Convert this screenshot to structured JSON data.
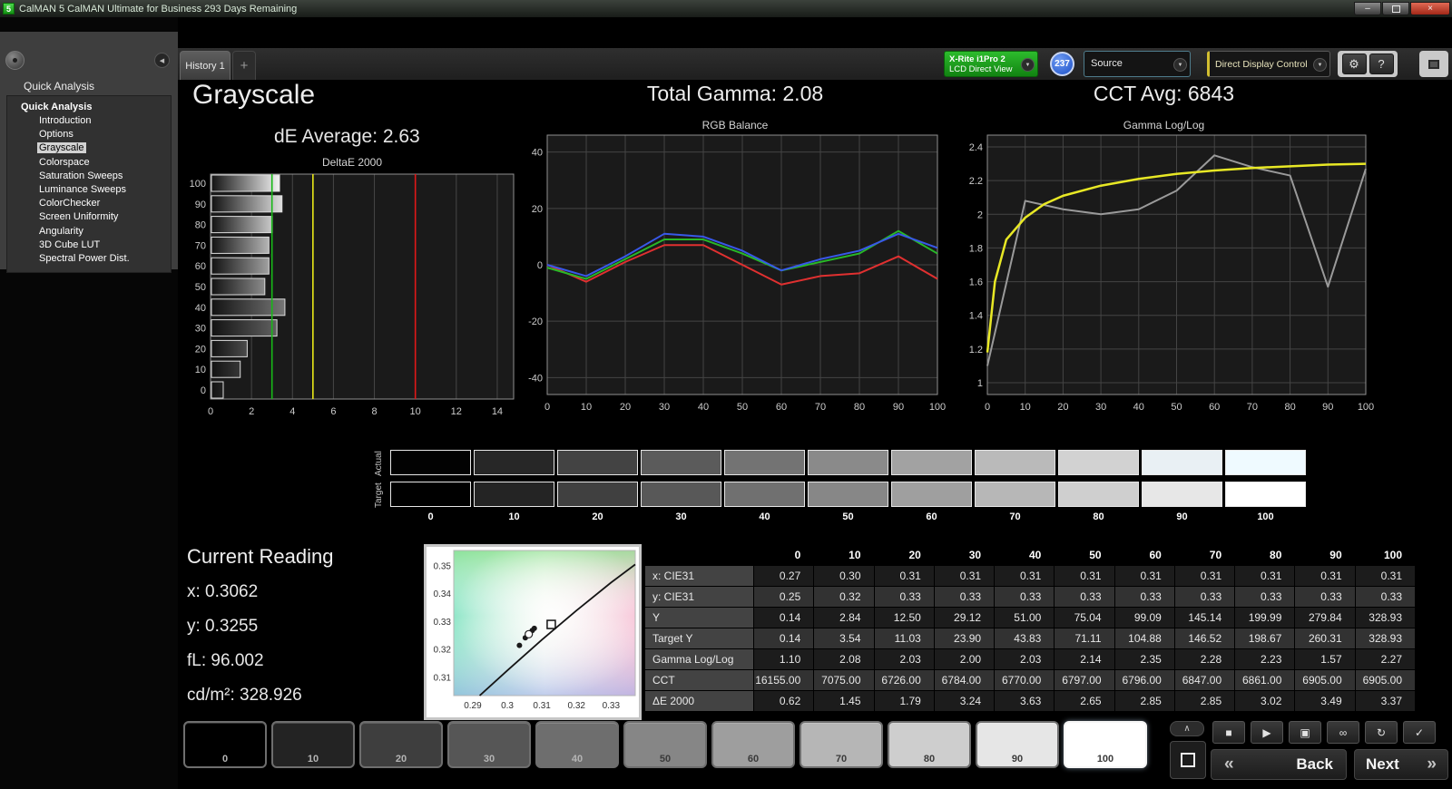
{
  "window": {
    "icon_label": "5",
    "title": "CalMAN 5 CalMAN Ultimate for Business 293 Days Remaining",
    "logo": "CalMAN 5",
    "minimize": "–",
    "close": "×"
  },
  "glyphs": {
    "caret_down": "▼",
    "collapse_left": "◀",
    "gear": "⚙"
  },
  "toolbar": {
    "history_tab": "History 1",
    "add_tab": "+",
    "meter": {
      "line1": "X-Rite i1Pro 2",
      "line2": "LCD Direct View"
    },
    "meter_badge": "237",
    "source_label": "Source",
    "display_control_label": "Direct Display Control",
    "help_label": "?"
  },
  "sidebar": {
    "header": "Quick Analysis",
    "root": "Quick Analysis",
    "items": [
      "Introduction",
      "Options",
      "Grayscale",
      "Colorspace",
      "Saturation Sweeps",
      "Luminance Sweeps",
      "ColorChecker",
      "Screen Uniformity",
      "Angularity",
      "3D Cube LUT",
      "Spectral Power Dist."
    ],
    "selected": "Grayscale"
  },
  "headings": {
    "page_title": "Grayscale",
    "de_average": "dE Average: 2.63",
    "total_gamma": "Total Gamma: 2.08",
    "cct_avg": "CCT Avg: 6843"
  },
  "chart_data": [
    {
      "type": "bar",
      "title": "DeltaE 2000",
      "orientation": "horizontal",
      "categories": [
        0,
        10,
        20,
        30,
        40,
        50,
        60,
        70,
        80,
        90,
        100
      ],
      "values": [
        0.62,
        1.45,
        1.79,
        3.24,
        3.63,
        2.65,
        2.85,
        2.85,
        3.02,
        3.49,
        3.37
      ],
      "xlim": [
        0,
        14.8
      ],
      "xticks": [
        0,
        2,
        4,
        6,
        8,
        10,
        12,
        14
      ],
      "reference_lines": [
        {
          "value": 3,
          "color": "#18b818"
        },
        {
          "value": 5,
          "color": "#e8e818"
        },
        {
          "value": 10,
          "color": "#e01818"
        }
      ]
    },
    {
      "type": "line",
      "title": "RGB Balance",
      "x": [
        0,
        10,
        20,
        30,
        40,
        50,
        60,
        70,
        80,
        90,
        100
      ],
      "ylim": [
        -46,
        46
      ],
      "yticks": [
        40,
        20,
        0,
        -20,
        -40
      ],
      "series": [
        {
          "name": "Red",
          "color": "#e03030",
          "values": [
            0,
            -6,
            1,
            7,
            7,
            0,
            -7,
            -4,
            -3,
            3,
            -5
          ]
        },
        {
          "name": "Green",
          "color": "#28b828",
          "values": [
            -1,
            -5,
            2,
            9,
            9,
            4,
            -2,
            1,
            4,
            12,
            4
          ]
        },
        {
          "name": "Blue",
          "color": "#3858e8",
          "values": [
            0,
            -4,
            3,
            11,
            10,
            5,
            -2,
            2,
            5,
            11,
            6
          ]
        }
      ]
    },
    {
      "type": "line",
      "title": "Gamma Log/Log",
      "x": [
        0,
        10,
        20,
        30,
        40,
        50,
        60,
        70,
        80,
        90,
        100
      ],
      "ylim": [
        0.93,
        2.47
      ],
      "yticks": [
        2.4,
        2.2,
        2,
        1.8,
        1.6,
        1.4,
        1.2,
        1
      ],
      "series": [
        {
          "name": "Measured",
          "color": "#9a9a9a",
          "values": [
            1.1,
            2.08,
            2.03,
            2.0,
            2.03,
            2.14,
            2.35,
            2.28,
            2.23,
            1.57,
            2.27
          ]
        }
      ],
      "target": {
        "name": "Target",
        "color": "#e8e825",
        "x": [
          0,
          2,
          5,
          10,
          15,
          20,
          30,
          40,
          50,
          60,
          70,
          80,
          90,
          100
        ],
        "y": [
          1.18,
          1.6,
          1.85,
          1.98,
          2.06,
          2.11,
          2.17,
          2.21,
          2.24,
          2.26,
          2.275,
          2.285,
          2.295,
          2.3
        ]
      }
    }
  ],
  "swatches": {
    "row_labels": [
      "Actual",
      "Target"
    ],
    "levels": [
      "0",
      "10",
      "20",
      "30",
      "40",
      "50",
      "60",
      "70",
      "80",
      "90",
      "100"
    ],
    "actual_colors": [
      "#020202",
      "#272727",
      "#434343",
      "#5b5b5b",
      "#737373",
      "#8a8a8a",
      "#a2a2a2",
      "#bababa",
      "#d2d2d2",
      "#e9f0f4",
      "#effaff"
    ],
    "target_colors": [
      "#000000",
      "#242424",
      "#404040",
      "#585858",
      "#707070",
      "#878787",
      "#9f9f9f",
      "#b7b7b7",
      "#cfcfcf",
      "#e7e7e7",
      "#ffffff"
    ]
  },
  "current_reading": {
    "title": "Current Reading",
    "lines": [
      {
        "label": "x:",
        "value": "0.3062"
      },
      {
        "label": "y:",
        "value": "0.3255"
      },
      {
        "label": "fL:",
        "value": "96.002"
      },
      {
        "label": "cd/m²:",
        "value": "328.926"
      }
    ]
  },
  "cie_chart": {
    "x_ticks": [
      "0.29",
      "0.3",
      "0.31",
      "0.32",
      "0.33"
    ],
    "y_ticks": [
      "0.35",
      "0.34",
      "0.33",
      "0.32",
      "0.31"
    ],
    "xlim": [
      0.2845,
      0.337
    ],
    "ylim": [
      0.3035,
      0.3555
    ],
    "locus": [
      [
        0.292,
        0.3035
      ],
      [
        0.3,
        0.3125
      ],
      [
        0.31,
        0.3235
      ],
      [
        0.32,
        0.334
      ],
      [
        0.33,
        0.344
      ],
      [
        0.337,
        0.3505
      ]
    ],
    "points": [
      [
        0.3035,
        0.3215
      ],
      [
        0.3052,
        0.3242
      ],
      [
        0.306,
        0.3252
      ],
      [
        0.3066,
        0.326
      ],
      [
        0.3072,
        0.3268
      ],
      [
        0.3078,
        0.3276
      ]
    ],
    "current_point": [
      0.3062,
      0.3255
    ],
    "target_point": [
      0.3127,
      0.329
    ]
  },
  "table": {
    "columns": [
      "0",
      "10",
      "20",
      "30",
      "40",
      "50",
      "60",
      "70",
      "80",
      "90",
      "100"
    ],
    "rows": [
      {
        "label": "x: CIE31",
        "values": [
          "0.27",
          "0.30",
          "0.31",
          "0.31",
          "0.31",
          "0.31",
          "0.31",
          "0.31",
          "0.31",
          "0.31",
          "0.31"
        ]
      },
      {
        "label": "y: CIE31",
        "values": [
          "0.25",
          "0.32",
          "0.33",
          "0.33",
          "0.33",
          "0.33",
          "0.33",
          "0.33",
          "0.33",
          "0.33",
          "0.33"
        ]
      },
      {
        "label": "Y",
        "values": [
          "0.14",
          "2.84",
          "12.50",
          "29.12",
          "51.00",
          "75.04",
          "99.09",
          "145.14",
          "199.99",
          "279.84",
          "328.93"
        ]
      },
      {
        "label": "Target Y",
        "values": [
          "0.14",
          "3.54",
          "11.03",
          "23.90",
          "43.83",
          "71.11",
          "104.88",
          "146.52",
          "198.67",
          "260.31",
          "328.93"
        ]
      },
      {
        "label": "Gamma Log/Log",
        "values": [
          "1.10",
          "2.08",
          "2.03",
          "2.00",
          "2.03",
          "2.14",
          "2.35",
          "2.28",
          "2.23",
          "1.57",
          "2.27"
        ]
      },
      {
        "label": "CCT",
        "values": [
          "16155.00",
          "7075.00",
          "6726.00",
          "6784.00",
          "6770.00",
          "6797.00",
          "6796.00",
          "6847.00",
          "6861.00",
          "6905.00",
          "6905.00"
        ]
      },
      {
        "label": "ΔE 2000",
        "values": [
          "0.62",
          "1.45",
          "1.79",
          "3.24",
          "3.63",
          "2.65",
          "2.85",
          "2.85",
          "3.02",
          "3.49",
          "3.37"
        ]
      }
    ]
  },
  "bottom_bar": {
    "levels": [
      "0",
      "10",
      "20",
      "30",
      "40",
      "50",
      "60",
      "70",
      "80",
      "90",
      "100"
    ],
    "colors": [
      "#000000",
      "#232323",
      "#3e3e3e",
      "#565656",
      "#6e6e6e",
      "#868686",
      "#9e9e9e",
      "#b6b6b6",
      "#cecece",
      "#e6e6e6",
      "#ffffff"
    ],
    "selected": "100",
    "transport": [
      {
        "name": "stop",
        "glyph": "■"
      },
      {
        "name": "play",
        "glyph": "▶"
      },
      {
        "name": "capture",
        "glyph": "▣"
      },
      {
        "name": "continuous",
        "glyph": "∞"
      },
      {
        "name": "loop",
        "glyph": "↻"
      },
      {
        "name": "accept",
        "glyph": "✓"
      }
    ],
    "expand_glyph": "∧",
    "back_arrow": "«",
    "back_label": "Back",
    "next_label": "Next",
    "next_arrow": "»"
  },
  "colors": {
    "accent_green": "#1fae1f",
    "badge_blue": "#2f6fe0",
    "ref_green": "#18b818",
    "ref_yellow": "#e8e818",
    "ref_red": "#e01818"
  }
}
